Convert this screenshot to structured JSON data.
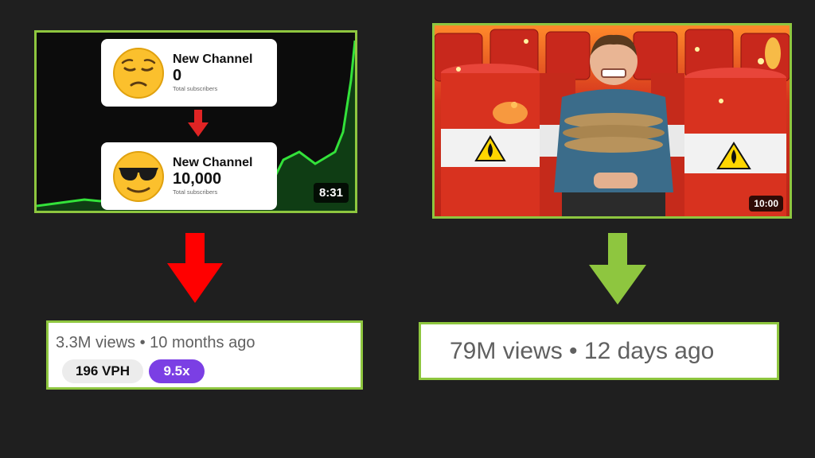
{
  "left_video": {
    "top_card": {
      "name": "New Channel",
      "count": "0",
      "sub": "Total subscribers",
      "emoji": "pensive-face"
    },
    "bottom_card": {
      "name": "New Channel",
      "count": "10,000",
      "sub": "Total subscribers",
      "emoji": "sunglasses-face"
    },
    "duration": "8:31",
    "stats": {
      "meta": "3.3M views • 10 months ago",
      "vph": "196 VPH",
      "multiplier": "9.5x"
    },
    "arrow_color": "#ff0000"
  },
  "right_video": {
    "duration": "10:00",
    "stats": {
      "meta": "79M views • 12 days ago"
    },
    "arrow_color": "#8ec63f"
  },
  "colors": {
    "background": "#1f1f1f",
    "border_green": "#8ec63f",
    "growth_line": "#33e23a",
    "badge_purple": "#7b3fe4"
  }
}
